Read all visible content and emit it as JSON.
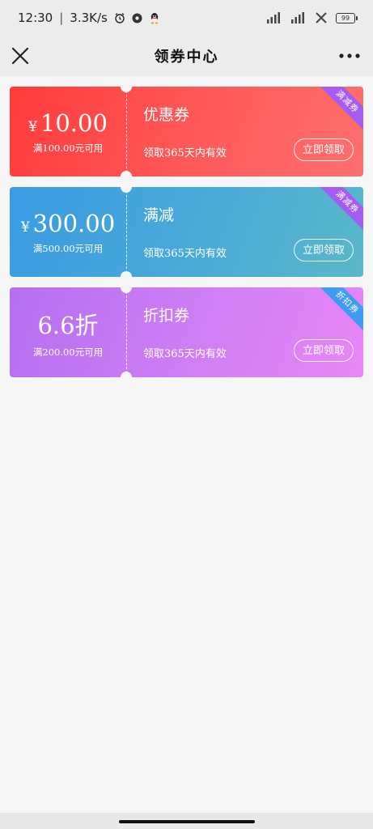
{
  "status_bar": {
    "time": "12:30",
    "separator": "|",
    "speed": "3.3K/s",
    "battery": "99"
  },
  "nav": {
    "title": "领券中心"
  },
  "coupons": [
    {
      "currency": "¥",
      "value": "10.00",
      "condition": "满100.00元可用",
      "name": "优惠券",
      "validity": "领取365天内有效",
      "button": "立即领取",
      "tag": "满减券"
    },
    {
      "currency": "¥",
      "value": "300.00",
      "condition": "满500.00元可用",
      "name": "满减",
      "validity": "领取365天内有效",
      "button": "立即领取",
      "tag": "满减券"
    },
    {
      "currency": "",
      "value": "6.6折",
      "condition": "满200.00元可用",
      "name": "折扣券",
      "validity": "领取365天内有效",
      "button": "立即领取",
      "tag": "折扣券"
    }
  ],
  "colors": {
    "red": "#ff4a4a",
    "blue": "#44a3dd",
    "purple": "#cc7df4",
    "tag_purple": "#a55cf2",
    "tag_blue": "#3e9cf2"
  }
}
